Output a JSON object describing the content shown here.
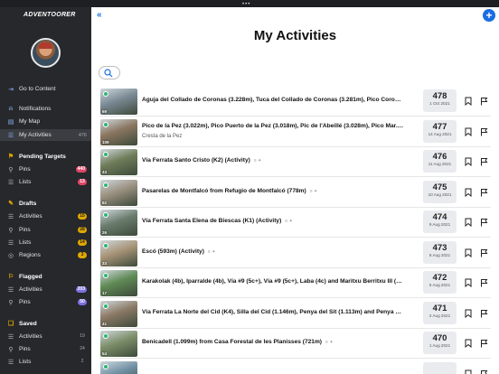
{
  "app": {
    "brand": "ADVENTOORER"
  },
  "sidebar": {
    "nav": [
      {
        "label": "Go to Content",
        "icon": "arrow-right-icon"
      },
      {
        "label": "Notifications",
        "icon": "bell-icon"
      },
      {
        "label": "My Map",
        "icon": "map-icon"
      },
      {
        "label": "My Activities",
        "icon": "list-icon",
        "count": "476",
        "active": true
      }
    ],
    "pending": {
      "title": "Pending Targets",
      "items": [
        {
          "label": "Pins",
          "count": "440",
          "color": "#e0466a"
        },
        {
          "label": "Lists",
          "count": "13",
          "color": "#e0466a"
        }
      ]
    },
    "drafts": {
      "title": "Drafts",
      "items": [
        {
          "label": "Activities",
          "count": "15",
          "color": "#e0a800"
        },
        {
          "label": "Pins",
          "count": "28",
          "color": "#e0a800"
        },
        {
          "label": "Lists",
          "count": "14",
          "color": "#e0a800"
        },
        {
          "label": "Regions",
          "count": "3",
          "color": "#e0a800"
        }
      ]
    },
    "flagged": {
      "title": "Flagged",
      "items": [
        {
          "label": "Activities",
          "count": "203",
          "color": "#7b6fe0"
        },
        {
          "label": "Pins",
          "count": "50",
          "color": "#7b6fe0"
        }
      ]
    },
    "saved": {
      "title": "Saved",
      "items": [
        {
          "label": "Activities",
          "count": "19"
        },
        {
          "label": "Pins",
          "count": "24"
        },
        {
          "label": "Lists",
          "count": "2"
        }
      ]
    }
  },
  "main": {
    "title": "My Activities",
    "activities": [
      {
        "title": "Aguja del Collado de Coronas (3.228m), Tuca del Collado de Coronas (3.281m), Pico Coron...",
        "subtitle": "",
        "id": "478",
        "date": "1 Oct 2021",
        "photos": "69",
        "img": "#7a8a95"
      },
      {
        "title": "Pico de la Pez (3.022m), Pico Puerto de la Pez (3.018m), Pic de l'Abeillé (3.028m), Pico Mar...",
        "subtitle": "Cresta de la Pez",
        "id": "477",
        "date": "14 Aug 2021",
        "photos": "109",
        "img": "#8a7560"
      },
      {
        "title": "Vía Ferrata Santo Cristo (K2) (Activity)",
        "subtitle": "",
        "id": "476",
        "date": "11 Aug 2021",
        "photos": "43",
        "img": "#6f7d5a"
      },
      {
        "title": "Pasarelas de Montfalcó from Refugio de Montfalcó (778m)",
        "subtitle": "",
        "id": "475",
        "date": "10 Aug 2021",
        "photos": "62",
        "img": "#9a9080"
      },
      {
        "title": "Vía Ferrata Santa Elena de Biescas (K1) (Activity)",
        "subtitle": "",
        "id": "474",
        "date": "9 Aug 2021",
        "photos": "26",
        "img": "#6b7d6e"
      },
      {
        "title": "Escó (593m) (Activity)",
        "subtitle": "",
        "id": "473",
        "date": "8 Aug 2021",
        "photos": "33",
        "img": "#a89478"
      },
      {
        "title": "Karakolak (4b), Iparralde (4b), Vía #9 (5c+), Vía #9 (5c+), Laba (4c) and Maritxu Berritxu III (4...",
        "subtitle": "",
        "id": "472",
        "date": "6 Aug 2021",
        "photos": "17",
        "img": "#5f8a55"
      },
      {
        "title": "Vía Ferrata La Norte del Cid (K4), Silla del Cid (1.146m), Penya del Sit (1.113m) and Penya d...",
        "subtitle": "",
        "id": "471",
        "date": "2 Aug 2021",
        "photos": "41",
        "img": "#8c7a66"
      },
      {
        "title": "Benicadell (1.099m) from Casa Forestal de les Planisses (721m)",
        "subtitle": "",
        "id": "470",
        "date": "1 Aug 2021",
        "photos": "54",
        "img": "#7d8f6a"
      },
      {
        "title": "",
        "subtitle": "",
        "id": "",
        "date": "",
        "photos": "",
        "img": "#6e8fa3"
      }
    ]
  }
}
